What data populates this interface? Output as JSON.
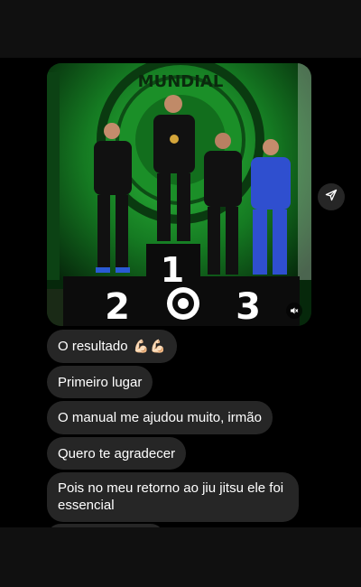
{
  "messages": [
    {
      "text": "O resultado",
      "emoji": "💪🏻💪🏻"
    },
    {
      "text": "Primeiro lugar"
    },
    {
      "text": "O manual me ajudou muito, irmão"
    },
    {
      "text": "Quero te agradecer"
    },
    {
      "text": "Pois no meu retorno ao jiu jitsu ele foi essencial"
    }
  ],
  "photo": {
    "banner_text": "MUNDIAL",
    "podium_numbers": [
      "2",
      "1",
      "3"
    ]
  },
  "icons": {
    "share": "share-icon",
    "mute": "speaker-muted-icon"
  },
  "colors": {
    "bubble": "#262626",
    "background": "#000000",
    "photo_green": "#1c9a2c"
  }
}
